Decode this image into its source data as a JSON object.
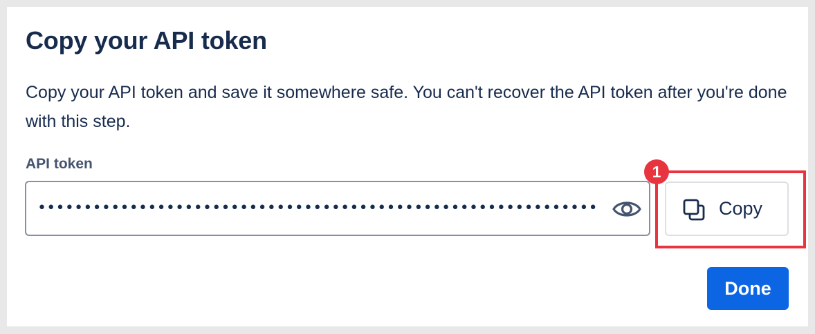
{
  "dialog": {
    "title": "Copy your API token",
    "description": "Copy your API token and save it somewhere safe. You can't recover the API token after you're done with this step.",
    "token_label": "API token",
    "token_value_masked": "••••••••••••••••••••••••••••••••••••••••••••••••••••••••••••••••••••",
    "show_token_icon": "eye-icon",
    "copy_button": {
      "label": "Copy",
      "icon": "copy-icon"
    },
    "done_button": {
      "label": "Done"
    }
  },
  "annotation": {
    "step_number": "1",
    "color": "#e8343f"
  },
  "colors": {
    "title_text": "#172b4d",
    "label_text": "#44546f",
    "primary": "#0c66e4",
    "field_border": "#8590a2"
  }
}
